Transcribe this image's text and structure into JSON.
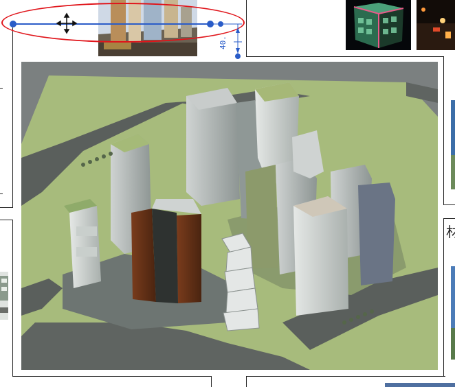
{
  "dimension": {
    "value": "40.",
    "color": "#2a5cc8"
  },
  "selection": {
    "ellipse_color": "#e0141a",
    "line_color": "#2a5cc8"
  },
  "edge_text": {
    "right_glyph": "材"
  },
  "icons": [
    "move-cursor-icon",
    "grip-handle-icon",
    "dimension-arrow-icon"
  ],
  "colors": {
    "frame": "#222222",
    "ground": "#a7bb7c",
    "road": "#5a5f5c",
    "sky": "#7b8080"
  }
}
